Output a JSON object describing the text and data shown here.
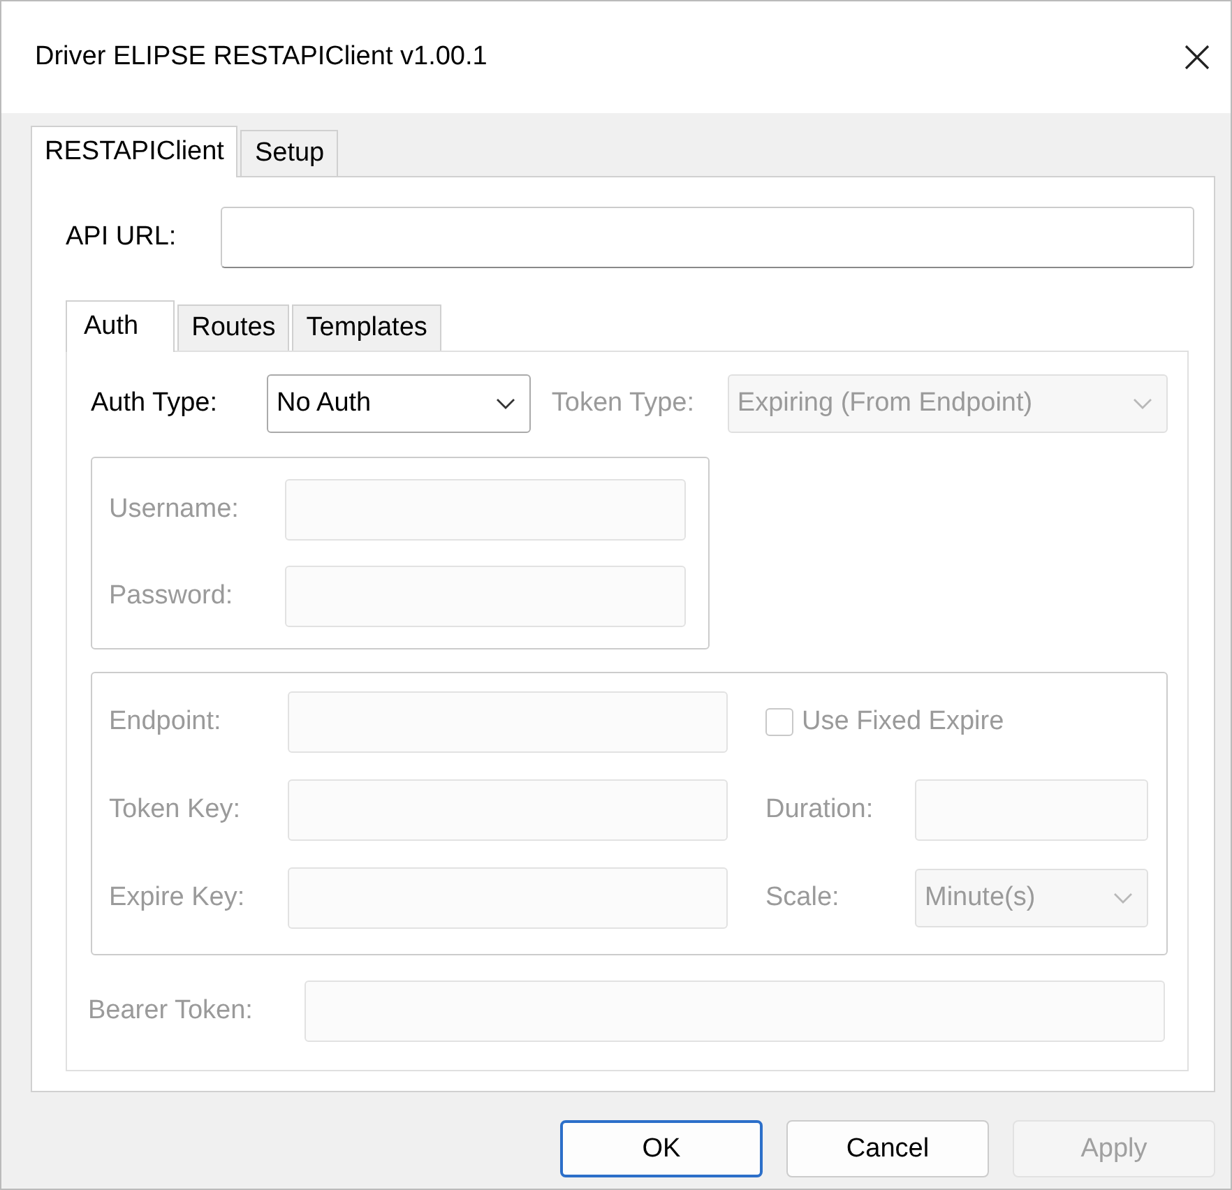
{
  "window": {
    "title": "Driver ELIPSE RESTAPIClient v1.00.1"
  },
  "tabs": [
    {
      "label": "RESTAPIClient",
      "selected": true
    },
    {
      "label": "Setup",
      "selected": false
    }
  ],
  "api_url": {
    "label": "API URL:"
  },
  "auth_tabs": [
    {
      "label": "Auth",
      "selected": true
    },
    {
      "label": "Routes",
      "selected": false
    },
    {
      "label": "Templates",
      "selected": false
    }
  ],
  "auth_type": {
    "label": "Auth Type:",
    "value": "No Auth",
    "disabled": false
  },
  "token_type": {
    "label": "Token Type:",
    "value": "Expiring (From Endpoint)",
    "disabled": true
  },
  "credentials": [
    {
      "label": "Username:",
      "disabled": true
    },
    {
      "label": "Password:",
      "disabled": true
    }
  ],
  "endpoint_fields": [
    {
      "label": "Endpoint:",
      "disabled": true
    },
    {
      "label": "Token Key:",
      "disabled": true
    },
    {
      "label": "Expire Key:",
      "disabled": true
    }
  ],
  "use_fixed_expire": {
    "label": "Use Fixed Expire",
    "checked": false,
    "disabled": true
  },
  "duration": {
    "label": "Duration:",
    "disabled": true
  },
  "scale": {
    "label": "Scale:",
    "value": "Minute(s)",
    "disabled": true
  },
  "bearer_token": {
    "label": "Bearer Token:",
    "disabled": true
  },
  "buttons": [
    {
      "label": "OK",
      "default": true,
      "disabled": false
    },
    {
      "label": "Cancel",
      "default": false,
      "disabled": false
    },
    {
      "label": "Apply",
      "default": false,
      "disabled": true
    }
  ]
}
